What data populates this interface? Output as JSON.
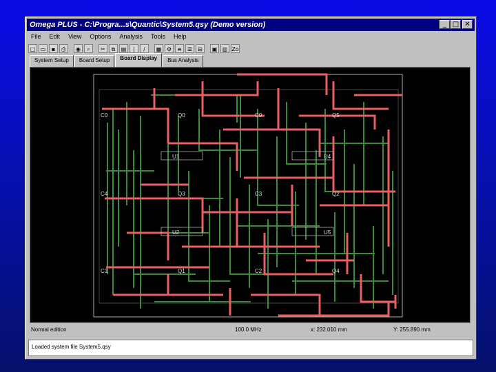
{
  "window": {
    "title": "Omega PLUS - C:\\Progra...s\\Quantic\\System5.qsy (Demo version)",
    "controls": [
      "_",
      "□",
      "✕"
    ]
  },
  "menu": [
    "File",
    "Edit",
    "View",
    "Options",
    "Analysis",
    "Tools",
    "Help"
  ],
  "toolbar": {
    "icons": [
      "new-icon",
      "open-icon",
      "save-icon",
      "print-icon",
      "eye-icon",
      "zoom-icon",
      "cut-icon",
      "copy-icon",
      "paste-icon",
      "line-icon",
      "draw-icon",
      "grid-icon",
      "tool-icon",
      "list-icon",
      "stack-icon",
      "layers-icon",
      "chip-icon",
      "board-icon",
      "zoom-to-fit-icon"
    ],
    "zoom_label": "Zo"
  },
  "tabs": [
    {
      "label": "System Setup",
      "active": false
    },
    {
      "label": "Board Setup",
      "active": false
    },
    {
      "label": "Board Display",
      "active": true
    },
    {
      "label": "Bus Analysis",
      "active": false
    }
  ],
  "board": {
    "components": [
      {
        "id": "C0",
        "name": "C0"
      },
      {
        "id": "C4",
        "name": "C4"
      },
      {
        "id": "C1",
        "name": "C1"
      },
      {
        "id": "Q0",
        "name": "Q0"
      },
      {
        "id": "C0b",
        "name": "C0"
      },
      {
        "id": "Q5",
        "name": "Q5"
      },
      {
        "id": "U1",
        "name": "U1"
      },
      {
        "id": "U4",
        "name": "U4"
      },
      {
        "id": "Q3",
        "name": "Q3"
      },
      {
        "id": "C3",
        "name": "C3"
      },
      {
        "id": "Q2",
        "name": "Q2"
      },
      {
        "id": "U2",
        "name": "U2"
      },
      {
        "id": "U5",
        "name": "U5"
      },
      {
        "id": "Q1",
        "name": "Q1"
      },
      {
        "id": "C2",
        "name": "C2"
      },
      {
        "id": "Q4",
        "name": "Q4"
      }
    ],
    "colors": {
      "red_trace": "#e86060",
      "green_trace": "#3c8c3c",
      "outline": "#b0b0b0"
    }
  },
  "status": {
    "left": "Normal edition",
    "frequency": "100.0 MHz",
    "x_coord": "x: 232.010 mm",
    "y_coord": "Y: 255.890 mm"
  },
  "message": "Loaded system file System5.qsy"
}
